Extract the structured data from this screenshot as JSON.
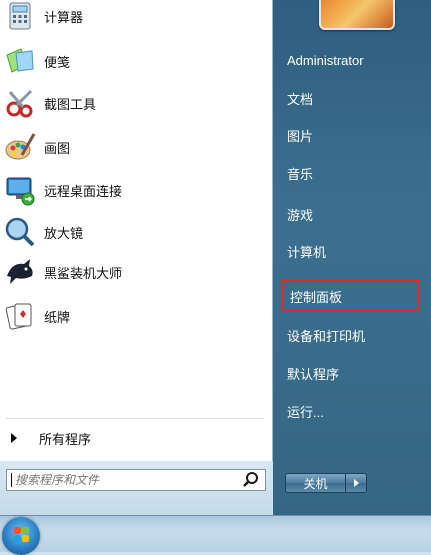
{
  "programs": [
    {
      "label": "计算器",
      "icon": "calculator-icon"
    },
    {
      "label": "便笺",
      "icon": "sticky-notes-icon"
    },
    {
      "label": "截图工具",
      "icon": "snipping-tool-icon"
    },
    {
      "label": "画图",
      "icon": "paint-icon"
    },
    {
      "label": "远程桌面连接",
      "icon": "remote-desktop-icon"
    },
    {
      "label": "放大镜",
      "icon": "magnifier-icon"
    },
    {
      "label": "黑鲨装机大师",
      "icon": "blackshark-icon"
    },
    {
      "label": "纸牌",
      "icon": "solitaire-icon"
    }
  ],
  "all_programs": "所有程序",
  "search": {
    "placeholder": "搜索程序和文件"
  },
  "right_menu": [
    "Administrator",
    "文档",
    "图片",
    "音乐",
    "游戏",
    "计算机",
    "控制面板",
    "设备和打印机",
    "默认程序",
    "运行..."
  ],
  "highlighted_item": "控制面板",
  "shutdown_label": "关机",
  "colors": {
    "highlight_border": "#e02828",
    "right_pane": "#3c6f8f"
  }
}
